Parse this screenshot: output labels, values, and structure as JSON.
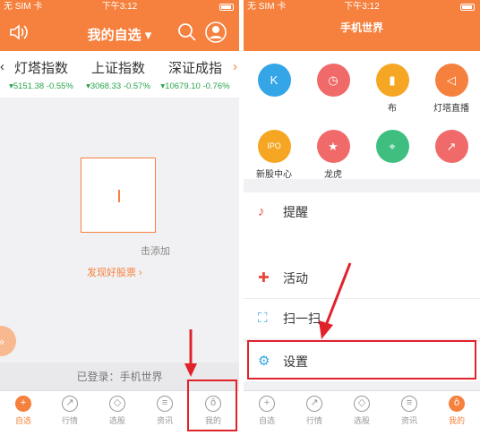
{
  "left": {
    "status": {
      "carrier": "无 SIM 卡",
      "time": "下午3:12"
    },
    "header": {
      "title": "我的自选 ▾"
    },
    "tickers": [
      {
        "name": "灯塔指数",
        "value": "▾5151.38 -0.55%"
      },
      {
        "name": "上证指数",
        "value": "▾3068.33 -0.57%"
      },
      {
        "name": "深证成指",
        "value": "▾10679.10 -0.76%"
      }
    ],
    "empty": {
      "add_hint": "击添加",
      "discover": "发现好股票 ›"
    },
    "login_status": "已登录：手机世界",
    "tabs": [
      "自选",
      "行情",
      "选股",
      "资讯",
      "我的"
    ]
  },
  "right": {
    "status": {
      "carrier": "无 SIM 卡",
      "time": "下午3:12"
    },
    "header": {
      "title": "手机世界"
    },
    "grid": [
      {
        "label": "",
        "icon": "K",
        "color": "#34a5e6"
      },
      {
        "label": "",
        "icon": "clock-icon",
        "color": "#f06a6a"
      },
      {
        "label": "布",
        "icon": "bars-icon",
        "color": "#f5a623"
      },
      {
        "label": "灯塔直播",
        "icon": "speaker-icon",
        "color": "#f6803d"
      },
      {
        "label": "新股中心",
        "icon": "IPO",
        "color": "#f5a623"
      },
      {
        "label": "龙虎",
        "icon": "star-icon",
        "color": "#f06a6a"
      },
      {
        "label": "",
        "icon": "location-icon",
        "color": "#3fbf7f"
      },
      {
        "label": "",
        "icon": "trend-icon",
        "color": "#f06a6a"
      }
    ],
    "menu": {
      "reminder": "提醒",
      "activity": "活动",
      "scan": "扫一扫",
      "settings": "设置"
    },
    "tabs": [
      "自选",
      "行情",
      "选股",
      "资讯",
      "我的"
    ]
  }
}
